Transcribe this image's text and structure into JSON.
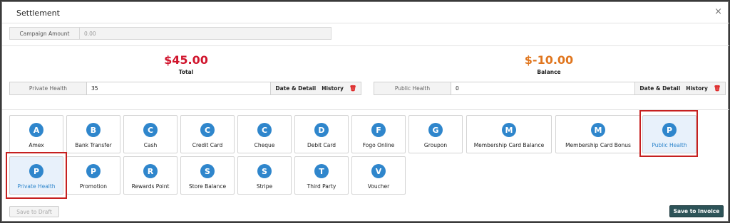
{
  "dialog": {
    "title": "Settlement",
    "close": "×"
  },
  "campaign": {
    "label": "Campaign Amount",
    "placeholder": "0.00"
  },
  "total": {
    "amount": "$45.00",
    "label": "Total",
    "color": "#d0142c"
  },
  "balance": {
    "amount": "$-10.00",
    "label": "Balance",
    "color": "#e0761f"
  },
  "private_row": {
    "label": "Private Health",
    "value": "35",
    "detail": "Date & Detail",
    "history": "History"
  },
  "public_row": {
    "label": "Public Health",
    "value": "0",
    "detail": "Date & Detail",
    "history": "History"
  },
  "methods": [
    {
      "letter": "A",
      "name": "Amex"
    },
    {
      "letter": "B",
      "name": "Bank Transfer"
    },
    {
      "letter": "C",
      "name": "Cash"
    },
    {
      "letter": "C",
      "name": "Credit Card"
    },
    {
      "letter": "C",
      "name": "Cheque"
    },
    {
      "letter": "D",
      "name": "Debit Card"
    },
    {
      "letter": "F",
      "name": "Fogo Online"
    },
    {
      "letter": "G",
      "name": "Groupon"
    },
    {
      "letter": "M",
      "name": "Membership Card Balance"
    },
    {
      "letter": "M",
      "name": "Membership Card Bonus"
    },
    {
      "letter": "P",
      "name": "Public Health",
      "selected": true
    },
    {
      "letter": "P",
      "name": "Private Health",
      "selected": true
    },
    {
      "letter": "P",
      "name": "Promotion"
    },
    {
      "letter": "R",
      "name": "Rewards Point"
    },
    {
      "letter": "S",
      "name": "Store Balance"
    },
    {
      "letter": "S",
      "name": "Stripe"
    },
    {
      "letter": "T",
      "name": "Third Party"
    },
    {
      "letter": "V",
      "name": "Voucher"
    }
  ],
  "buttons": {
    "draft": "Save to Draft",
    "save": "Save to Invoice"
  }
}
